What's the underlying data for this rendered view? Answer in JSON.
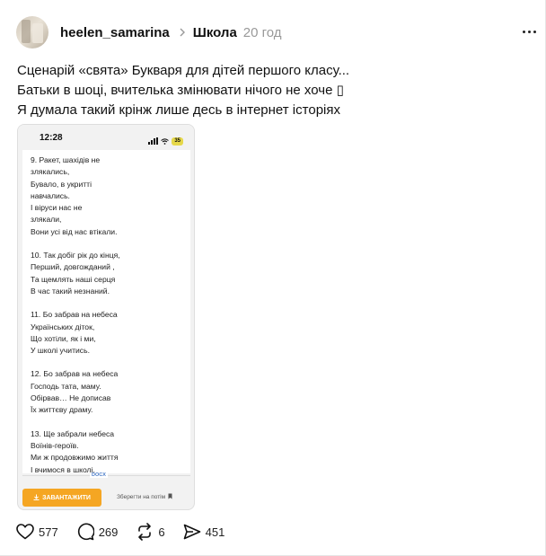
{
  "post": {
    "username": "heelen_samarina",
    "topic": "Школа",
    "time": "20 год",
    "text_lines": [
      "Сценарій «свята» Букваря для дітей першого класу...",
      "Батьки в шоці, вчителька змінювати нічого не хоче ▯",
      "Я думала такий крінж лише десь в інтернет історіях"
    ]
  },
  "media": {
    "clock": "12:28",
    "battery": "35",
    "stanzas": [
      [
        "9. Ракет, шахідів не",
        "злякались,",
        "Бувало, в укритті",
        "навчались.",
        "І віруси нас не",
        "злякали,",
        "Вони усі від нас втікали."
      ],
      [
        "10. Так добіг рік до кінця,",
        "Перший, довгожданий ,",
        "Та щемлять наші серця",
        "В час такий незнаний."
      ],
      [
        "11. Бо забрав на небеса",
        "Українських діток,",
        "Що хотіли, як і ми,",
        "У школі учитись."
      ],
      [
        "12. Бо забрав на небеса",
        "Господь тата, маму.",
        "Обірвав… Не дописав",
        "Їх життєву драму."
      ],
      [
        "13. Ще забрали небеса",
        "Воїнів-героїв.",
        "Ми ж продовжимо життя",
        "І вчимося в школі."
      ]
    ],
    "docx_label": "DOCX",
    "download_label": "ЗАВАНТАЖИТИ",
    "save_later_label": "Зберегти на потім"
  },
  "actions": {
    "likes": "577",
    "comments": "269",
    "reposts": "6",
    "shares": "451"
  },
  "icons": {
    "like": "heart-icon",
    "comment": "comment-icon",
    "repost": "repost-icon",
    "share": "send-icon",
    "more": "more-icon"
  }
}
